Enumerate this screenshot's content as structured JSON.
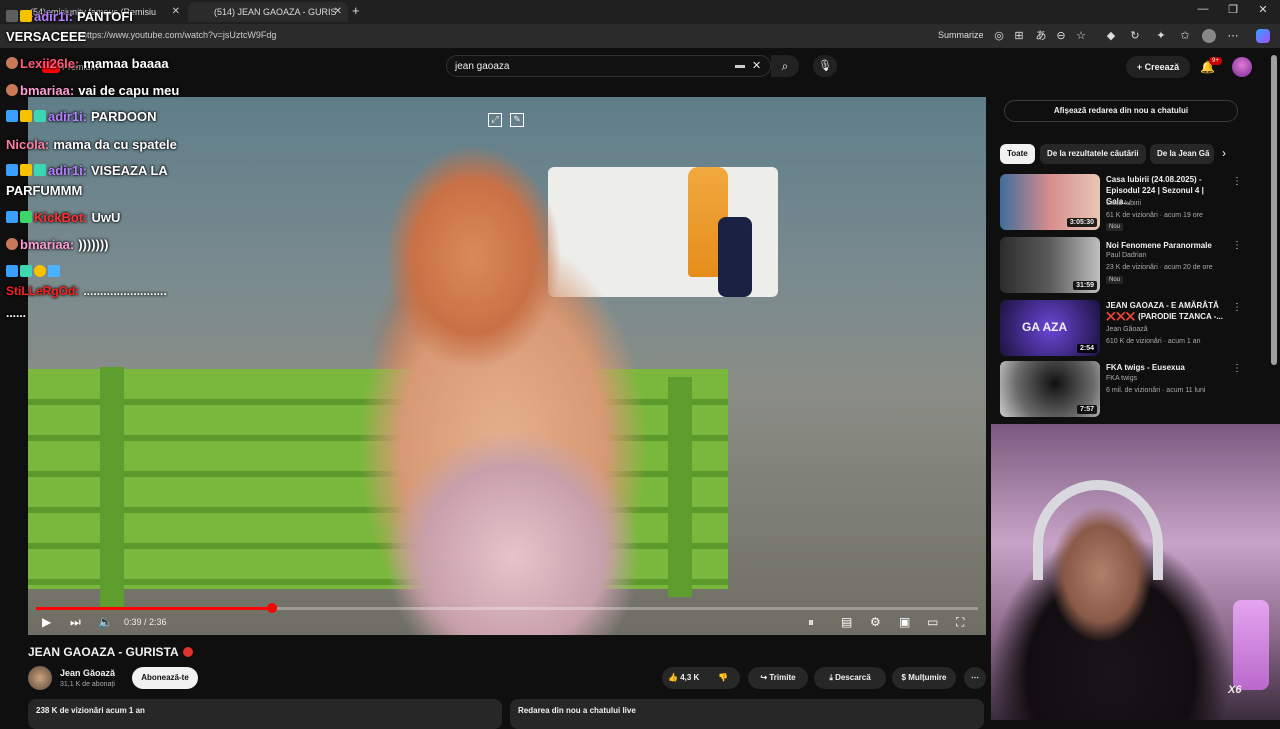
{
  "browser": {
    "tabs": [
      {
        "label": "(54)emisiunity famous (Remisiu"
      },
      {
        "label": "(514) JEAN GAOAZA - GURIS"
      }
    ],
    "url": "https://www.youtube.com/watch?v=jsUztcW9Fdg",
    "summarize_label": "Summarize"
  },
  "youtube": {
    "logo_suffix": "Premium",
    "search_value": "jean gaoaza",
    "create_label": "Creează",
    "notification_count": "9+"
  },
  "video": {
    "time": "0:39 / 2:36",
    "progress": 0.25,
    "title": "JEAN GAOAZA - GURISTA",
    "channel": "Jean Găoază",
    "subscribers": "31,1 K de abonați",
    "subscribe_label": "Abonează-te",
    "likes": "4,3 K",
    "share_label": "Trimite",
    "download_label": "Descarcă",
    "thanks_label": "Mulțumire",
    "description": "238 K de vizionări  acum 1 an",
    "live_chat_label": "Redarea din nou a chatului live"
  },
  "chat": [
    {
      "name": "adir1i:",
      "name_color": "#b57fff",
      "text": "PANTOFI"
    },
    {
      "name": "",
      "name_color": "#ffffff",
      "text": "VERSACEEE"
    },
    {
      "name": "Lexii26le:",
      "name_color": "#ff5a7a",
      "text": "mamaa baaaa"
    },
    {
      "name": "bmariaa:",
      "name_color": "#ff9ed6",
      "text": "vai de capu meu"
    },
    {
      "name": "adir1i:",
      "name_color": "#b57fff",
      "text": "PARDOON"
    },
    {
      "name": "Nicola:",
      "name_color": "#ff7fa0",
      "text": "mama da cu spatele"
    },
    {
      "name": "adir1i:",
      "name_color": "#b57fff",
      "text": "VISEAZA LA"
    },
    {
      "name": "",
      "name_color": "#ffffff",
      "text": "PARFUMMM"
    },
    {
      "name": "KickBot:",
      "name_color": "#ff3030",
      "text": "UwU"
    },
    {
      "name": "bmariaa:",
      "name_color": "#ff9ed6",
      "text": ")))))))"
    },
    {
      "name": "",
      "name_color": "#ffffff",
      "text": ""
    },
    {
      "name": "StiLLeRgOd:",
      "name_color": "#ff2020",
      "text": "........................."
    },
    {
      "name": "",
      "name_color": "#ffffff",
      "text": "......"
    }
  ],
  "sidebar": {
    "chat_replay_label": "Afișează redarea din nou a chatului",
    "chips": [
      "Toate",
      "De la rezultatele căutării",
      "De la Jean Gă"
    ],
    "recommendations": [
      {
        "title": "Casa Iubirii (24.08.2025) - Episodul 224 | Sezonul 4 | Gala...",
        "channel": "Casa Iubirii",
        "meta": "61 K de vizionări · acum 19 ore",
        "badge": "Nou",
        "duration": "3:05:30"
      },
      {
        "title": "Noi Fenomene Paranormale",
        "channel": "Paul Dadrian",
        "meta": "23 K de vizionări · acum 20 de ore",
        "badge": "Nou",
        "duration": "31:59"
      },
      {
        "title": "JEAN GAOAZA - E AMĂRÂTĂ ❌❌❌ (PARODIE TZANCA -...",
        "channel": "Jean Găoază",
        "meta": "610 K de vizionări · acum 1 an",
        "badge": "",
        "duration": "2:54",
        "thumb_text": "GA AZA"
      },
      {
        "title": "FKA twigs - Eusexua",
        "channel": "FKA twigs",
        "meta": "6 mil. de vizionări · acum 11 luni",
        "badge": "",
        "duration": "7:57"
      }
    ]
  },
  "webcam": {
    "multiplier": "X6"
  },
  "colors": {
    "accent": "#ff0000",
    "bg": "#0f0f0f"
  }
}
